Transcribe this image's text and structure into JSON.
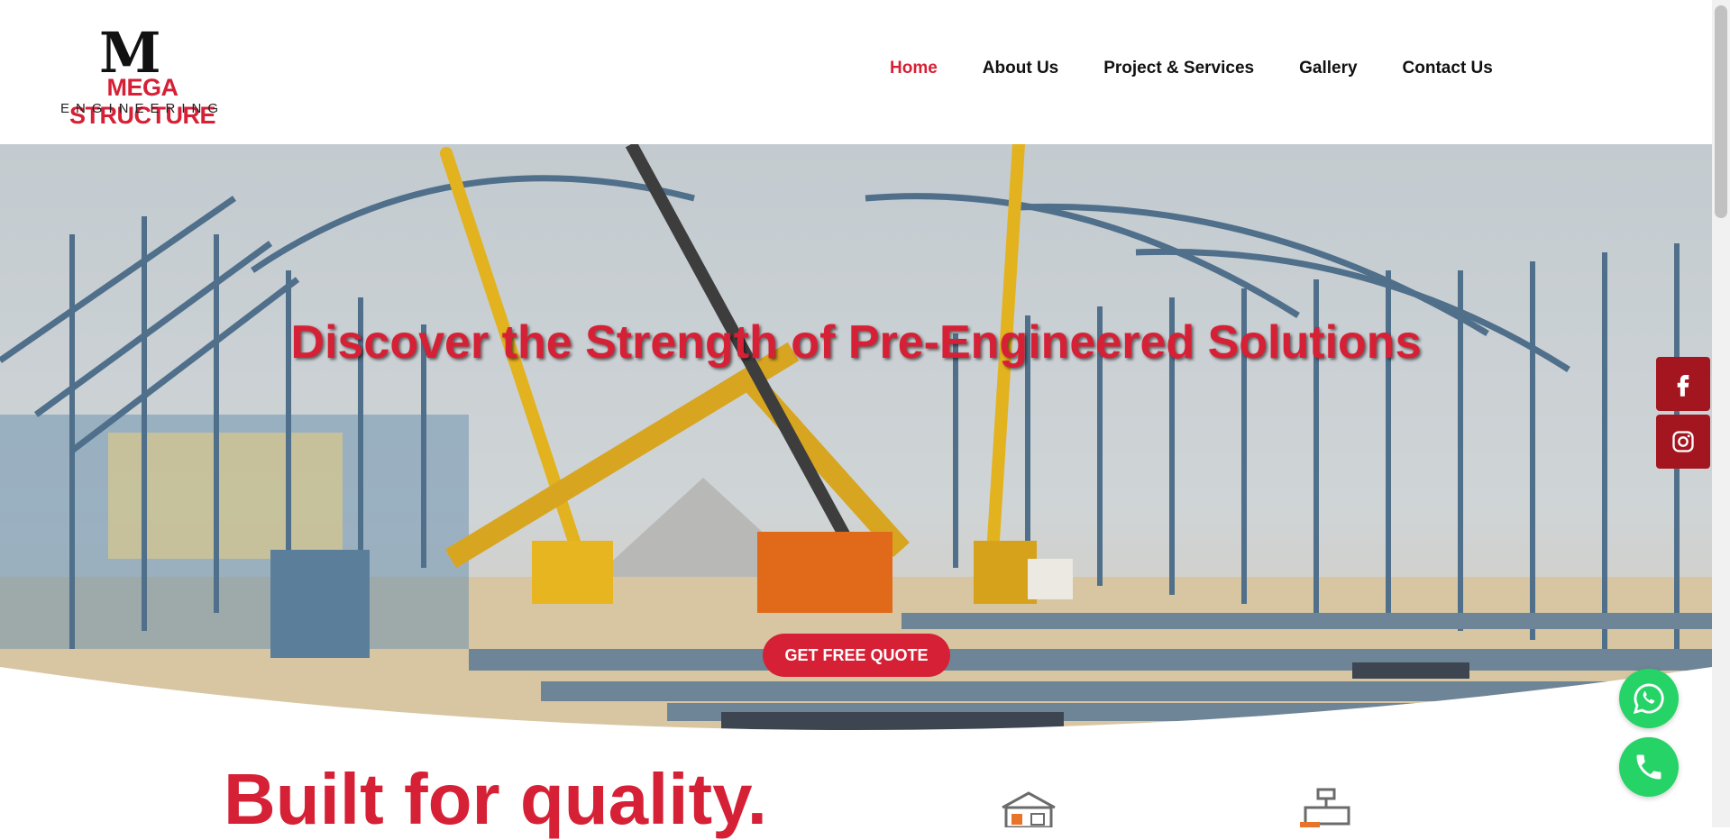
{
  "logo": {
    "mark": "M",
    "name": "MEGA STRUCTURE",
    "tagline": "ENGINEERING"
  },
  "nav": {
    "items": [
      {
        "label": "Home",
        "active": true
      },
      {
        "label": "About Us"
      },
      {
        "label": "Project & Services"
      },
      {
        "label": "Gallery"
      },
      {
        "label": "Contact Us"
      }
    ]
  },
  "hero": {
    "title": "Discover the Strength of Pre-Engineered Solutions",
    "cta": "GET FREE QUOTE"
  },
  "social": {
    "facebook_icon": "facebook-icon",
    "instagram_icon": "instagram-icon"
  },
  "floating": {
    "whatsapp_icon": "whatsapp-icon",
    "phone_icon": "phone-icon"
  },
  "section": {
    "heading": "Built for quality."
  },
  "colors": {
    "accent": "#d62035",
    "social_bg": "#a4161f",
    "whatsapp": "#25d366"
  }
}
